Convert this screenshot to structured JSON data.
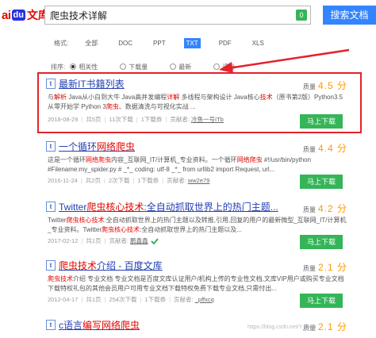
{
  "header": {
    "logo_prefix": "ai",
    "logo_du": "du",
    "logo_wenku": "文库",
    "search_value": "爬虫技术详解",
    "search_badge": "0",
    "search_button": "搜索文档"
  },
  "format": {
    "label": "格式:",
    "items": [
      "全部",
      "DOC",
      "PPT",
      "TXT",
      "PDF",
      "XLS"
    ],
    "active": "TXT"
  },
  "sort": {
    "label": "排序:",
    "items": [
      "相关性",
      "下载量",
      "最新",
      "评分"
    ],
    "selected": "相关性"
  },
  "results": [
    {
      "icon": "t",
      "title_plain": "最新IT书籍列表",
      "snippet": [
        "与",
        "解析",
        " Java从小白到大牛 Java高并发编程",
        "详解",
        " 多线程与架构设计 Java核心",
        "技术",
        "（原书第2版）Python3.5从零开始学 Python 3",
        "爬虫",
        "、数据清洗与可视化实战 ..."
      ],
      "date": "2018-08-29",
      "pages": "共5页",
      "downloads": "11次下载",
      "cost": "1下载券",
      "contributor_label": "贡献者:",
      "contributor": "冷鱼一号ITb",
      "quality_label": "质量",
      "quality_value": "4.5 分",
      "download_label": "马上下载"
    },
    {
      "icon": "t",
      "title_pre": "一个循环",
      "title_em": "网络爬虫",
      "snippet": [
        "这是一个循环",
        "网络爬虫",
        "内容_互联网_IT/计算机_专业资料。一个循环",
        "网络爬虫",
        " #!/usr/bin/python #Filename:my_spider.py # _*_ coding: utf-8 _*_ from urllib2 import Request, url..."
      ],
      "date": "2016-11-24",
      "pages": "共2页",
      "downloads": "2次下载",
      "cost": "1下载券",
      "contributor_label": "贡献者:",
      "contributor": "ww2e79",
      "quality_label": "质量",
      "quality_value": "4.4 分",
      "download_label": "马上下载"
    },
    {
      "icon": "t",
      "title_pre": "Twitter",
      "title_em": "爬虫核心技术",
      "title_post": ":全自动抓取世界上的热门主题...",
      "snippet": [
        "Twitter",
        "爬虫核心技术",
        ":全自动抓取世界上的热门主题以及转推,引用,回复的用户的最新微型_互联网_IT/计算机_专业资料。Twitter",
        "爬虫核心技术",
        ":全自动抓取世界上的热门主题以及..."
      ],
      "date": "2017-02-12",
      "pages": "共1页",
      "downloads": "",
      "cost": "",
      "contributor_label": "贡献者:",
      "contributor": "鹏鑫鑫",
      "quality_label": "质量",
      "quality_value": "4.2 分",
      "download_label": "马上下载"
    },
    {
      "icon": "t",
      "title_pre": "",
      "title_em": "爬虫技术",
      "title_post": "介绍 - 百度文库",
      "snippet": [
        "爬虫技术",
        "介绍 专业文档 专业文档是百度文库认证用户/机构上传的专业性文档,文库VIP用户或购买专业文档下载特权礼包的其他会员用户可用专业文档下载特权免费下载专业文档,只需付出..."
      ],
      "date": "2012-04-17",
      "pages": "共1页",
      "downloads": "254次下载",
      "cost": "1下载券",
      "contributor_label": "贡献者:",
      "contributor": "_pffxcq",
      "quality_label": "质量",
      "quality_value": "2.1 分",
      "download_label": "马上下载"
    },
    {
      "icon": "t",
      "title_pre": "c语言",
      "title_em": "编写网络爬虫",
      "quality_label": "质量",
      "quality_value": "2.1 分"
    }
  ],
  "watermark": "https://blog.csdn.net/Y_ingh",
  "colors": {
    "brand_red": "#e10601",
    "link_blue": "#2440b3",
    "search_blue": "#3385ff",
    "download_green": "#35b558",
    "highlight_red": "#e3232b",
    "star_orange": "#ff9900"
  }
}
